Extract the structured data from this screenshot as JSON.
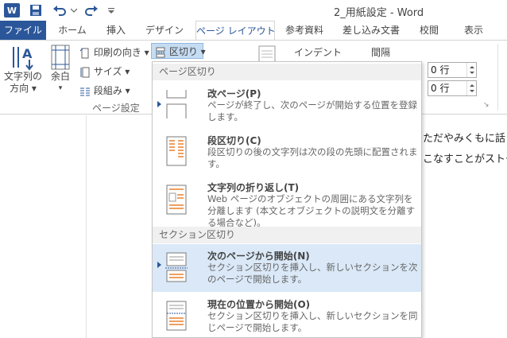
{
  "window": {
    "app_icon": "W",
    "title": "2_用紙設定 - Word"
  },
  "tabs": [
    {
      "label": "ファイル"
    },
    {
      "label": "ホーム"
    },
    {
      "label": "挿入"
    },
    {
      "label": "デザイン"
    },
    {
      "label": "ページ レイアウト"
    },
    {
      "label": "参考資料"
    },
    {
      "label": "差し込み文書"
    },
    {
      "label": "校閲"
    },
    {
      "label": "表示"
    }
  ],
  "ribbon": {
    "text_direction_line1": "文字列の",
    "text_direction_line2": "方向",
    "margins": "余白",
    "orientation": "印刷の向き",
    "size": "サイズ",
    "columns": "段組み",
    "breaks": "区切り",
    "group_page_setup": "ページ設定",
    "indent_header": "インデント",
    "spacing_header": "間隔",
    "spacing_before": "0 行",
    "spacing_after": "0 行"
  },
  "document": {
    "line1": "ただやみくもに話し",
    "line2": "こなすことがストー"
  },
  "breaks_menu": {
    "section_page_breaks": "ページ区切り",
    "section_section_breaks": "セクション区切り",
    "items": [
      {
        "title": "改ページ(P)",
        "desc": "ページが終了し、次のページが開始する位置を登録します。"
      },
      {
        "title": "段区切り(C)",
        "desc": "段区切りの後の文字列は次の段の先頭に配置されます。"
      },
      {
        "title": "文字列の折り返し(T)",
        "desc": "Web ページのオブジェクトの周囲にある文字列を分離します (本文とオブジェクトの説明文を分離する場合など)。"
      },
      {
        "title": "次のページから開始(N)",
        "desc": "セクション区切りを挿入し、新しいセクションを次のページで開始します。"
      },
      {
        "title": "現在の位置から開始(O)",
        "desc": "セクション区切りを挿入し、新しいセクションを同じページで開始します。"
      }
    ]
  },
  "colors": {
    "accent": "#2b579a",
    "highlight": "#dae8f7",
    "orange": "#e8812b"
  }
}
